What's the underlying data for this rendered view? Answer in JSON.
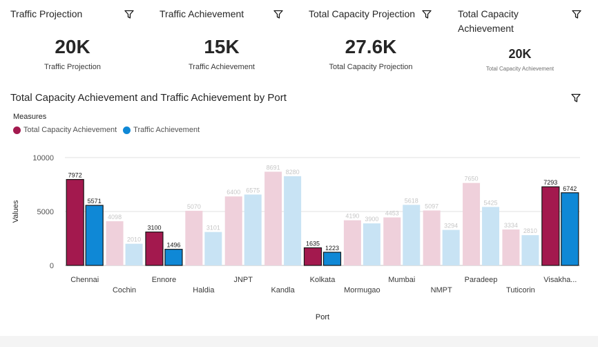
{
  "kpis": [
    {
      "title": "Traffic Projection",
      "value": "20K",
      "label": "Traffic Projection"
    },
    {
      "title": "Traffic Achievement",
      "value": "15K",
      "label": "Traffic Achievement"
    },
    {
      "title": "Total Capacity Projection",
      "value": "27.6K",
      "label": "Total Capacity Projection"
    },
    {
      "title": "Total Capacity Achievement",
      "value": "20K",
      "label": "Total Capacity Achievement"
    }
  ],
  "chart": {
    "title": "Total Capacity Achievement and Traffic Achievement by Port",
    "measures_label": "Measures"
  },
  "colors": {
    "series1": "#a3194e",
    "series2": "#0f88d6",
    "series1_faded": "#efd0db",
    "series2_faded": "#c8e3f4"
  },
  "icons": [
    "filter-icon"
  ],
  "chart_data": {
    "type": "bar",
    "title": "Total Capacity Achievement and Traffic Achievement by Port",
    "xlabel": "Port",
    "ylabel": "Values",
    "ylim": [
      0,
      10000
    ],
    "yticks": [
      0,
      5000,
      10000
    ],
    "grid": true,
    "legend_placement": "top-left",
    "categories": [
      "Chennai",
      "Cochin",
      "Ennore",
      "Haldia",
      "JNPT",
      "Kandla",
      "Kolkata",
      "Mormugao",
      "Mumbai",
      "NMPT",
      "Paradeep",
      "Tuticorin",
      "Visakha..."
    ],
    "highlighted": [
      true,
      false,
      true,
      false,
      false,
      false,
      true,
      false,
      false,
      false,
      false,
      false,
      true
    ],
    "series": [
      {
        "name": "Total Capacity Achievement",
        "values": [
          7972,
          4098,
          3100,
          5070,
          6400,
          8691,
          1635,
          4190,
          4453,
          5097,
          7650,
          3334,
          7293
        ]
      },
      {
        "name": "Traffic Achievement",
        "values": [
          5571,
          2010,
          1496,
          3101,
          6575,
          8280,
          1223,
          3900,
          5618,
          3294,
          5425,
          2810,
          6742
        ]
      }
    ]
  }
}
